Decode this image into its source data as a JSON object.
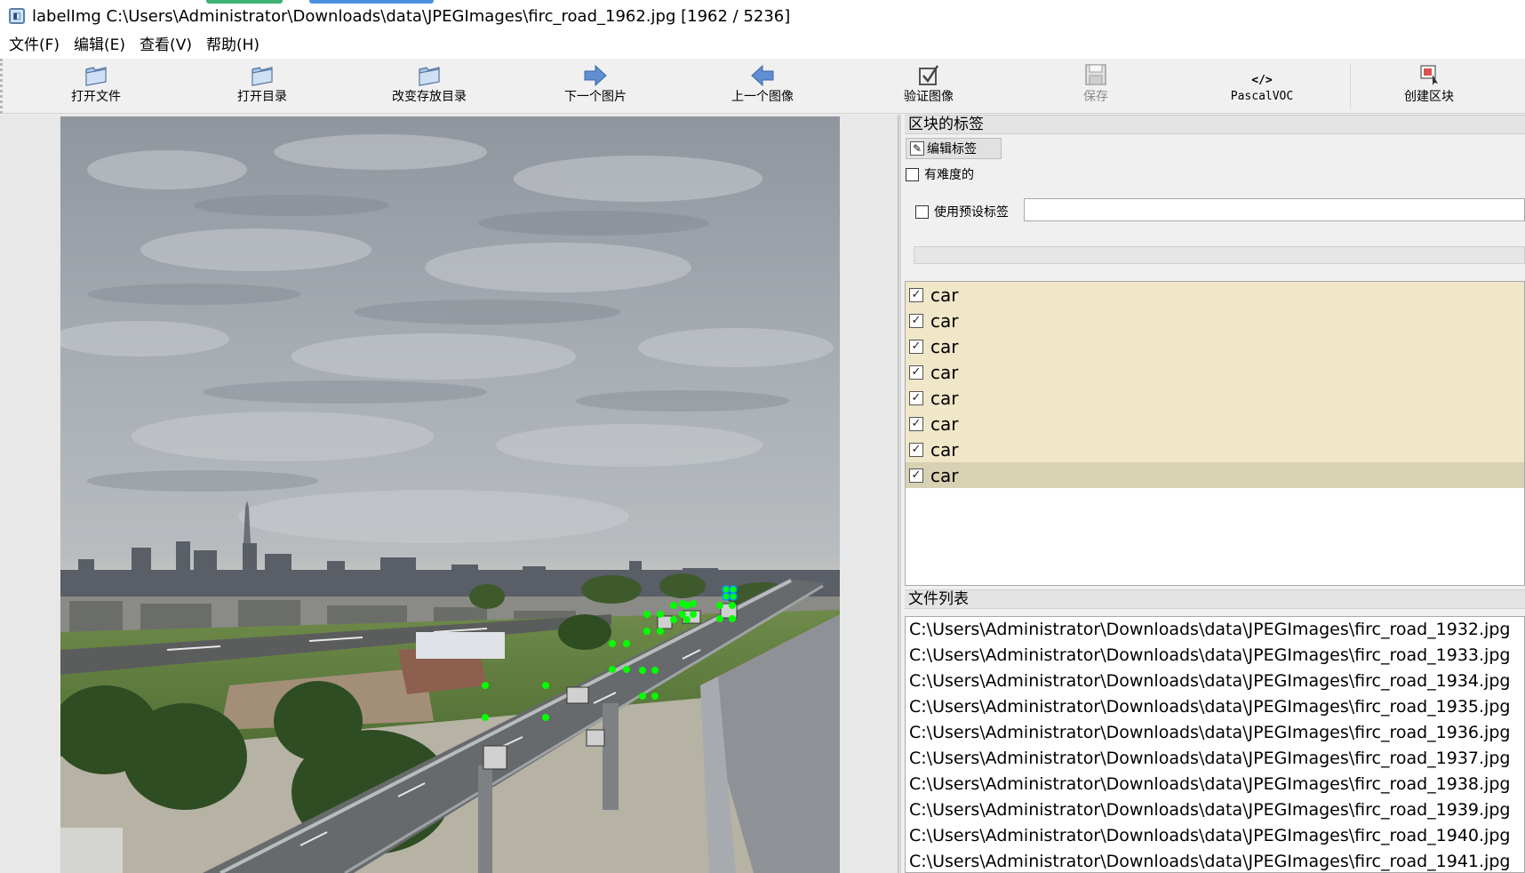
{
  "window": {
    "title": "labelImg C:\\Users\\Administrator\\Downloads\\data\\JPEGImages\\firc_road_1962.jpg [1962 / 5236]",
    "app_icon": "app-icon"
  },
  "menu": {
    "items": [
      {
        "label": "文件(F)"
      },
      {
        "label": "编辑(E)"
      },
      {
        "label": "查看(V)"
      },
      {
        "label": "帮助(H)"
      }
    ]
  },
  "toolbar": {
    "items": [
      {
        "label": "打开文件",
        "icon": "folder-icon",
        "enabled": true
      },
      {
        "label": "打开目录",
        "icon": "folder-icon",
        "enabled": true
      },
      {
        "label": "改变存放目录",
        "icon": "folder-icon",
        "enabled": true
      },
      {
        "label": "下一个图片",
        "icon": "arrow-right-icon",
        "enabled": true
      },
      {
        "label": "上一个图像",
        "icon": "arrow-left-icon",
        "enabled": true
      },
      {
        "label": "验证图像",
        "icon": "checkbox-icon",
        "enabled": true
      },
      {
        "label": "保存",
        "icon": "save-icon",
        "enabled": false
      },
      {
        "label": "PascalVOC",
        "icon": "code-icon",
        "icon_text": "</>",
        "enabled": true
      },
      {
        "label": "创建区块",
        "icon": "create-box-icon",
        "enabled": true
      }
    ]
  },
  "dock": {
    "labels_header": "区块的标签",
    "edit_label_button": "编辑标签",
    "difficult_label": "有难度的",
    "difficult_checked": false,
    "use_default_label": "使用预设标签",
    "use_default_checked": false,
    "default_label_value": "",
    "labels": [
      {
        "text": "car",
        "checked": true,
        "selected": false
      },
      {
        "text": "car",
        "checked": true,
        "selected": false
      },
      {
        "text": "car",
        "checked": true,
        "selected": false
      },
      {
        "text": "car",
        "checked": true,
        "selected": false
      },
      {
        "text": "car",
        "checked": true,
        "selected": false
      },
      {
        "text": "car",
        "checked": true,
        "selected": false
      },
      {
        "text": "car",
        "checked": true,
        "selected": false
      },
      {
        "text": "car",
        "checked": true,
        "selected": true
      }
    ],
    "files_header": "文件列表",
    "files": [
      "C:\\Users\\Administrator\\Downloads\\data\\JPEGImages\\firc_road_1932.jpg",
      "C:\\Users\\Administrator\\Downloads\\data\\JPEGImages\\firc_road_1933.jpg",
      "C:\\Users\\Administrator\\Downloads\\data\\JPEGImages\\firc_road_1934.jpg",
      "C:\\Users\\Administrator\\Downloads\\data\\JPEGImages\\firc_road_1935.jpg",
      "C:\\Users\\Administrator\\Downloads\\data\\JPEGImages\\firc_road_1936.jpg",
      "C:\\Users\\Administrator\\Downloads\\data\\JPEGImages\\firc_road_1937.jpg",
      "C:\\Users\\Administrator\\Downloads\\data\\JPEGImages\\firc_road_1938.jpg",
      "C:\\Users\\Administrator\\Downloads\\data\\JPEGImages\\firc_road_1939.jpg",
      "C:\\Users\\Administrator\\Downloads\\data\\JPEGImages\\firc_road_1940.jpg",
      "C:\\Users\\Administrator\\Downloads\\data\\JPEGImages\\firc_road_1941.jpg"
    ]
  },
  "colors": {
    "label_row_bg": "#f0e6c8",
    "label_row_selected_bg": "#d9d1b4",
    "bbox_handle": "#00ff00",
    "bbox_selected_handle": "#00aaff"
  }
}
